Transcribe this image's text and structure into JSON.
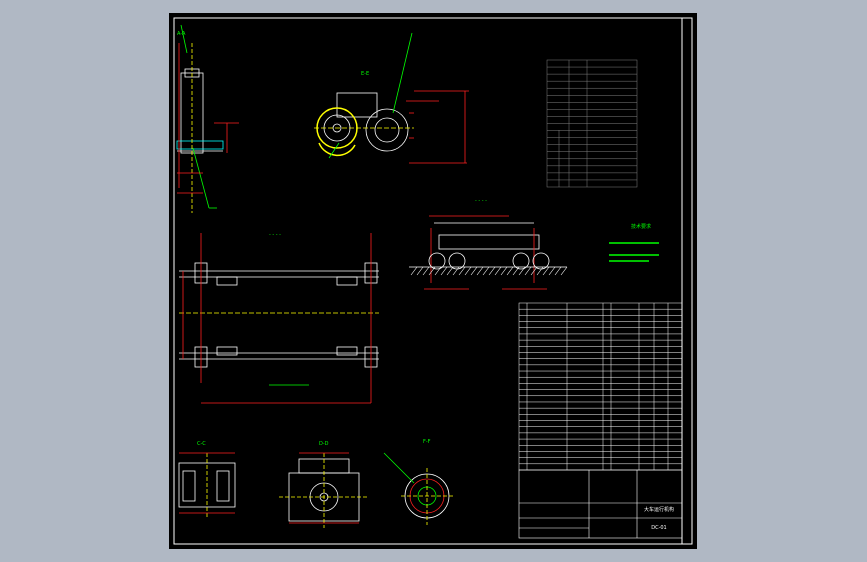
{
  "drawing": {
    "background_color": "#000000",
    "frame_color": "#ffffff",
    "line_colors": {
      "outline": "#ffffff",
      "dimension": "#ff2020",
      "leader": "#00ff00",
      "center": "#ffff00"
    },
    "section_labels": [
      "A-A",
      "E-E",
      "C-C",
      "D-D",
      "F-F"
    ],
    "title_block": {
      "title": "大车运行机构",
      "drawing_no": "DC-01"
    },
    "params_rows": 18,
    "bom_rows": 27,
    "notes_heading": "技术要求"
  }
}
